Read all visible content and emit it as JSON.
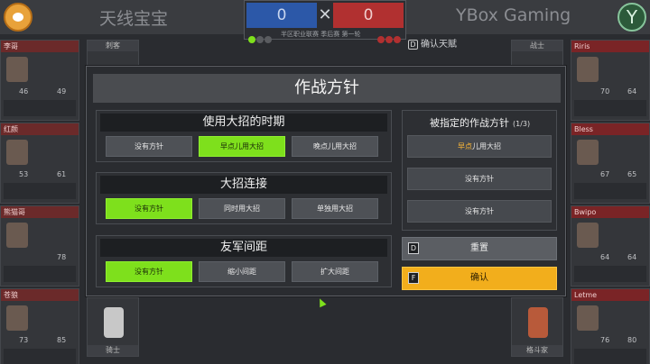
{
  "header": {
    "team_left": "天线宝宝",
    "team_right": "YBox Gaming",
    "score_left": "0",
    "score_right": "0",
    "round_label": "半区职业联赛 季后赛 第一轮",
    "talent_hint_key": "D",
    "talent_hint": "确认天赋"
  },
  "left_players": [
    {
      "name": "李哥",
      "atk": "46",
      "hp": "49"
    },
    {
      "name": "红颜",
      "atk": "53",
      "hp": "61"
    },
    {
      "name": "熊猫哥",
      "atk": "",
      "hp": "78"
    },
    {
      "name": "苍狼",
      "atk": "73",
      "hp": "85"
    }
  ],
  "right_players": [
    {
      "name": "Riris",
      "atk": "70",
      "hp": "64"
    },
    {
      "name": "Bless",
      "atk": "67",
      "hp": "65"
    },
    {
      "name": "Bwipo",
      "atk": "64",
      "hp": "64"
    },
    {
      "name": "Letme",
      "atk": "76",
      "hp": "80"
    }
  ],
  "mid_cards": {
    "top_left": "刺客",
    "top_right": "战士",
    "bottom_left": "骑士",
    "bottom_right": "格斗家"
  },
  "modal": {
    "title": "作战方针",
    "groups": [
      {
        "title": "使用大招的时期",
        "options": [
          "没有方针",
          "早点儿用大招",
          "晚点儿用大招"
        ],
        "selected": 1
      },
      {
        "title": "大招连接",
        "options": [
          "没有方针",
          "同时用大招",
          "单独用大招"
        ],
        "selected": 0
      },
      {
        "title": "友军间距",
        "options": [
          "没有方针",
          "缩小间距",
          "扩大间距"
        ],
        "selected": 0
      }
    ],
    "assigned": {
      "title": "被指定的作战方针",
      "count": "(1/3)",
      "slots": [
        {
          "hl": "早点",
          "rest": "儿用大招"
        },
        {
          "hl": "",
          "rest": "没有方针"
        },
        {
          "hl": "",
          "rest": "没有方针"
        }
      ]
    },
    "reset_key": "D",
    "reset_label": "重置",
    "confirm_key": "F",
    "confirm_label": "确认"
  },
  "colors": {
    "selected_option": "#7ee01c",
    "confirm_button": "#f2ae1c",
    "blue_team": "#2c58a8",
    "red_team": "#b13030"
  }
}
